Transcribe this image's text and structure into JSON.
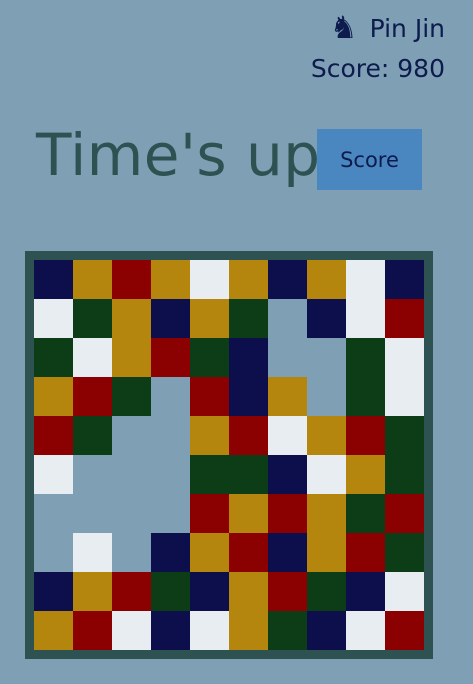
{
  "header": {
    "player_icon": "chess-knight-icon",
    "player_name": "Pin Jin",
    "score_text": "Score: 980"
  },
  "status": {
    "title": "Time's up"
  },
  "actions": {
    "score_label": "Score"
  },
  "colors": {
    "N": "#0d0f4d",
    "Y": "#b5860d",
    "R": "#8b0000",
    "W": "#e8edf2",
    "G": "#0c3d16",
    ".": "#7f9fb5",
    "border": "#2e5252",
    "button": "#4a87c0",
    "background": "#7f9fb5"
  },
  "board": {
    "legend": {
      "N": "navy",
      "Y": "gold",
      "R": "red",
      "W": "white",
      "G": "green",
      ".": "empty"
    },
    "rows": [
      "NYRYWYNYWN",
      "WGYNYG.NWR",
      "GWYRGN..GW",
      "YRG.RNY.GW",
      "RG..YRWYRG",
      "W...GGNWYG",
      "....RYRYGR",
      ".W.NYRNYRG",
      "NYRGNYRGNW",
      "YRWNWYGNWR"
    ]
  }
}
